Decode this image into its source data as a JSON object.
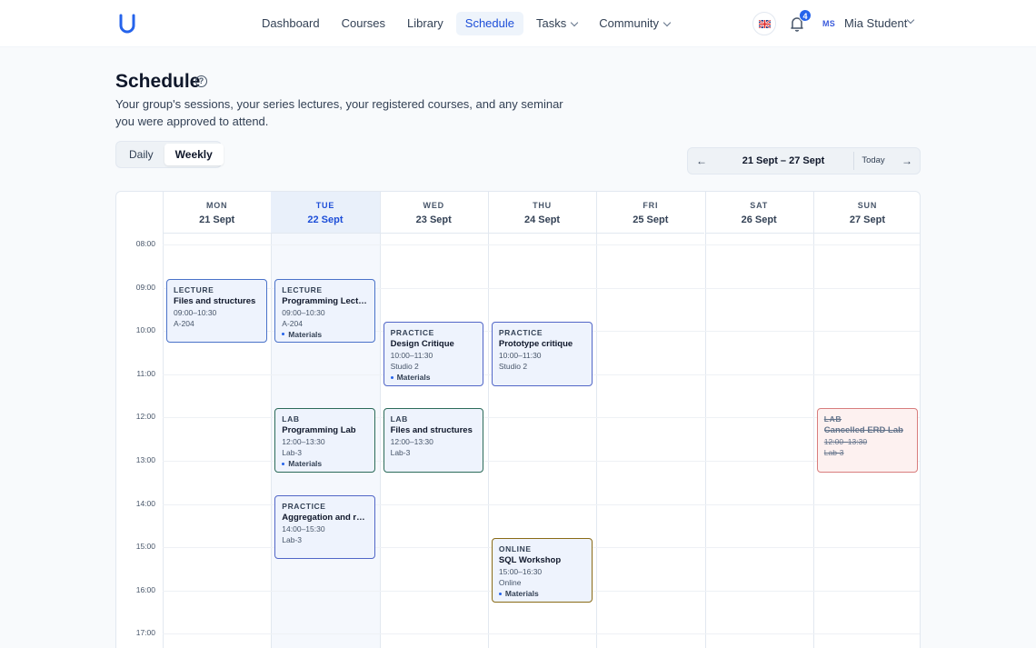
{
  "nav": {
    "items": [
      {
        "label": "Dashboard",
        "active": false,
        "dropdown": false
      },
      {
        "label": "Courses",
        "active": false,
        "dropdown": false
      },
      {
        "label": "Library",
        "active": false,
        "dropdown": false
      },
      {
        "label": "Schedule",
        "active": true,
        "dropdown": false
      },
      {
        "label": "Tasks",
        "active": false,
        "dropdown": true
      },
      {
        "label": "Community",
        "active": false,
        "dropdown": true
      }
    ]
  },
  "header_right": {
    "notification_count": "4",
    "user_initials": "MS",
    "user_name": "Mia Student"
  },
  "page": {
    "title": "Schedule",
    "description": "Your group's sessions, your series lectures, your registered courses, and any seminar you were approved to attend."
  },
  "view_toggle": {
    "options": [
      "Daily",
      "Weekly"
    ],
    "selected": "Weekly"
  },
  "date_nav": {
    "prev": "←",
    "range": "21 Sept – 27 Sept",
    "today": "Today",
    "next": "→"
  },
  "calendar": {
    "days": [
      {
        "dow": "MON",
        "date": "21 Sept",
        "today": false
      },
      {
        "dow": "TUE",
        "date": "22 Sept",
        "today": true
      },
      {
        "dow": "WED",
        "date": "23 Sept",
        "today": false
      },
      {
        "dow": "THU",
        "date": "24 Sept",
        "today": false
      },
      {
        "dow": "FRI",
        "date": "25 Sept",
        "today": false
      },
      {
        "dow": "SAT",
        "date": "26 Sept",
        "today": false
      },
      {
        "dow": "SUN",
        "date": "27 Sept",
        "today": false
      }
    ],
    "hours": [
      "08:00",
      "09:00",
      "10:00",
      "11:00",
      "12:00",
      "13:00",
      "14:00",
      "15:00",
      "16:00",
      "17:00"
    ],
    "events": [
      {
        "day": 0,
        "start": 9,
        "end": 10.5,
        "kind": "lecture",
        "type": "LECTURE",
        "title": "Files and structures",
        "time": "09:00–10:30",
        "room": "A-204",
        "materials": ""
      },
      {
        "day": 1,
        "start": 9,
        "end": 10.5,
        "kind": "lecture",
        "type": "LECTURE",
        "title": "Programming Lecture",
        "time": "09:00–10:30",
        "room": "A-204",
        "materials": "Materials"
      },
      {
        "day": 2,
        "start": 10,
        "end": 11.5,
        "kind": "practice",
        "type": "PRACTICE",
        "title": "Design Critique",
        "time": "10:00–11:30",
        "room": "Studio 2",
        "materials": "Materials"
      },
      {
        "day": 3,
        "start": 10,
        "end": 11.5,
        "kind": "practice",
        "type": "PRACTICE",
        "title": "Prototype critique",
        "time": "10:00–11:30",
        "room": "Studio 2",
        "materials": ""
      },
      {
        "day": 1,
        "start": 12,
        "end": 13.5,
        "kind": "lab",
        "type": "LAB",
        "title": "Programming Lab",
        "time": "12:00–13:30",
        "room": "Lab-3",
        "materials": "Materials"
      },
      {
        "day": 2,
        "start": 12,
        "end": 13.5,
        "kind": "lab",
        "type": "LAB",
        "title": "Files and structures",
        "time": "12:00–13:30",
        "room": "Lab-3",
        "materials": ""
      },
      {
        "day": 6,
        "start": 12,
        "end": 13.5,
        "kind": "cancelled",
        "type": "LAB",
        "title": "Cancelled ERD Lab",
        "time": "12:00–13:30",
        "room": "Lab-3",
        "materials": ""
      },
      {
        "day": 1,
        "start": 14,
        "end": 15.5,
        "kind": "practice",
        "type": "PRACTICE",
        "title": "Aggregation and reports",
        "time": "14:00–15:30",
        "room": "Lab-3",
        "materials": ""
      },
      {
        "day": 3,
        "start": 15,
        "end": 16.5,
        "kind": "online",
        "type": "ONLINE",
        "title": "SQL Workshop",
        "time": "15:00–16:30",
        "room": "Online",
        "materials": "Materials"
      }
    ]
  }
}
